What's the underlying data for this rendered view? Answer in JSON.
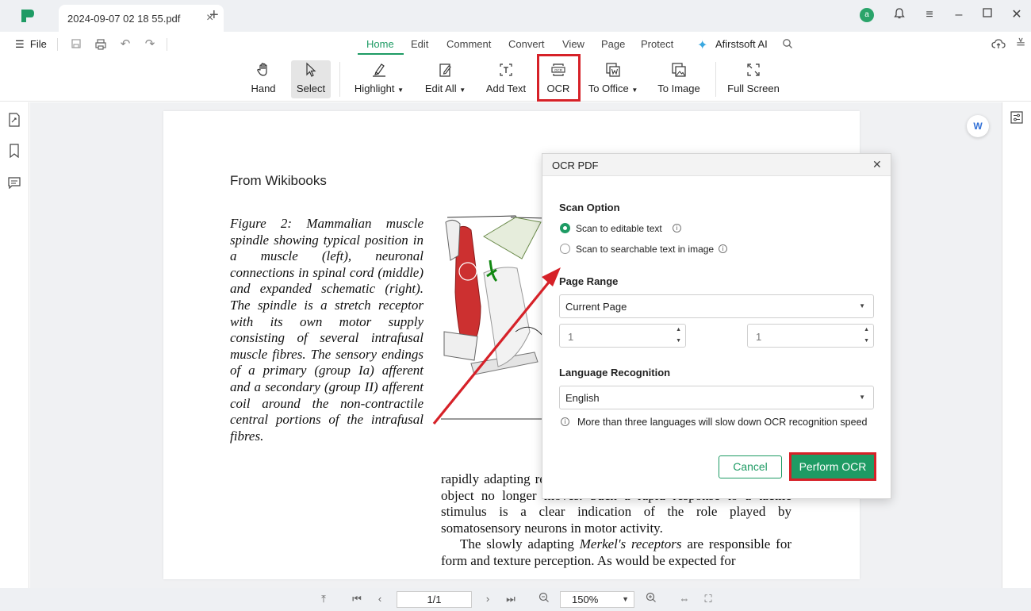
{
  "window": {
    "tab_title": "2024-09-07 02 18 55.pdf",
    "avatar_letter": "a"
  },
  "menubar": {
    "file_label": "File",
    "tabs": [
      "Home",
      "Edit",
      "Comment",
      "Convert",
      "View",
      "Page",
      "Protect"
    ],
    "active_tab": "Home",
    "ai_label": "Afirstsoft AI"
  },
  "ribbon": {
    "buttons": [
      {
        "label": "Hand",
        "icon": "hand-icon"
      },
      {
        "label": "Select",
        "icon": "cursor-icon",
        "selected": true
      },
      {
        "label": "Highlight",
        "icon": "highlighter-icon",
        "dropdown": true
      },
      {
        "label": "Edit All",
        "icon": "edit-icon",
        "dropdown": true
      },
      {
        "label": "Add Text",
        "icon": "add-text-icon"
      },
      {
        "label": "OCR",
        "icon": "ocr-icon",
        "highlighted": true
      },
      {
        "label": "To Office",
        "icon": "to-office-icon",
        "dropdown": true
      },
      {
        "label": "To Image",
        "icon": "to-image-icon"
      },
      {
        "label": "Full Screen",
        "icon": "full-screen-icon"
      }
    ]
  },
  "document": {
    "heading": "From Wikibooks",
    "caption": "Figure 2: Mammalian muscle spindle showing typical position in a muscle (left), neuronal connections in spinal cord (middle) and expanded schematic (right). The spindle is a stretch receptor with its own motor supply consisting of several intrafusal muscle fibres. The sensory endings of a primary (group Ia) afferent and a secondary (group II) afferent coil around the non-contractile central portions of the intrafusal fibres.",
    "body_p1": "rapidly adapting receptors respond reflexively until the gripped object no longer moves. Such a rapid response to a tactile stimulus is a clear indication of the role played by somatosensory neurons in motor activity.",
    "body_p2_prefix": "The slowly adapting ",
    "body_p2_italic": "Merkel's receptors",
    "body_p2_suffix": " are responsible for form and texture perception. As would be expected for"
  },
  "dialog": {
    "title": "OCR PDF",
    "scan_option_title": "Scan Option",
    "scan_options": [
      "Scan to editable text",
      "Scan to searchable text in image"
    ],
    "scan_selected": 0,
    "page_range_title": "Page Range",
    "page_range_value": "Current Page",
    "range_from": "1",
    "range_to": "1",
    "language_title": "Language Recognition",
    "language_value": "English",
    "note": "More than three languages will slow down OCR recognition speed",
    "cancel_label": "Cancel",
    "perform_label": "Perform OCR"
  },
  "statusbar": {
    "page_indicator": "1/1",
    "zoom": "150%"
  },
  "colors": {
    "accent": "#1e9b64",
    "highlight_red": "#d62128"
  }
}
